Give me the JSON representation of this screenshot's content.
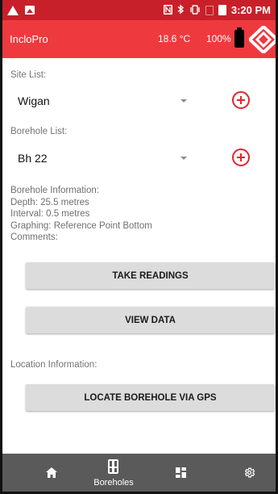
{
  "status_bar": {
    "time": "3:20 PM",
    "icons": [
      "alert-icon",
      "image-icon",
      "nfc-icon",
      "bluetooth-icon",
      "vibrate-icon",
      "no-sim-icon",
      "battery-icon"
    ]
  },
  "app_bar": {
    "title": "IncloPro",
    "temperature": "18.6 °C",
    "battery_percent": "100%",
    "color": "#ee3a3f"
  },
  "site": {
    "label": "Site List:",
    "selected": "Wigan"
  },
  "borehole": {
    "label": "Borehole List:",
    "selected": "Bh 22"
  },
  "borehole_info": {
    "heading": "Borehole Information:",
    "depth": "Depth: 25.5 metres",
    "interval": "Interval: 0.5 metres",
    "graphing": "Graphing: Reference Point Bottom",
    "comments": "Comments:"
  },
  "buttons": {
    "take_readings": "TAKE READINGS",
    "view_data": "VIEW DATA",
    "locate_gps": "LOCATE BOREHOLE VIA GPS"
  },
  "location": {
    "label": "Location Information:"
  },
  "bottom_nav": {
    "items": [
      {
        "icon": "home-icon",
        "label": ""
      },
      {
        "icon": "borehole-icon",
        "label": "Boreholes"
      },
      {
        "icon": "dashboard-icon",
        "label": ""
      },
      {
        "icon": "settings-icon",
        "label": ""
      }
    ]
  }
}
